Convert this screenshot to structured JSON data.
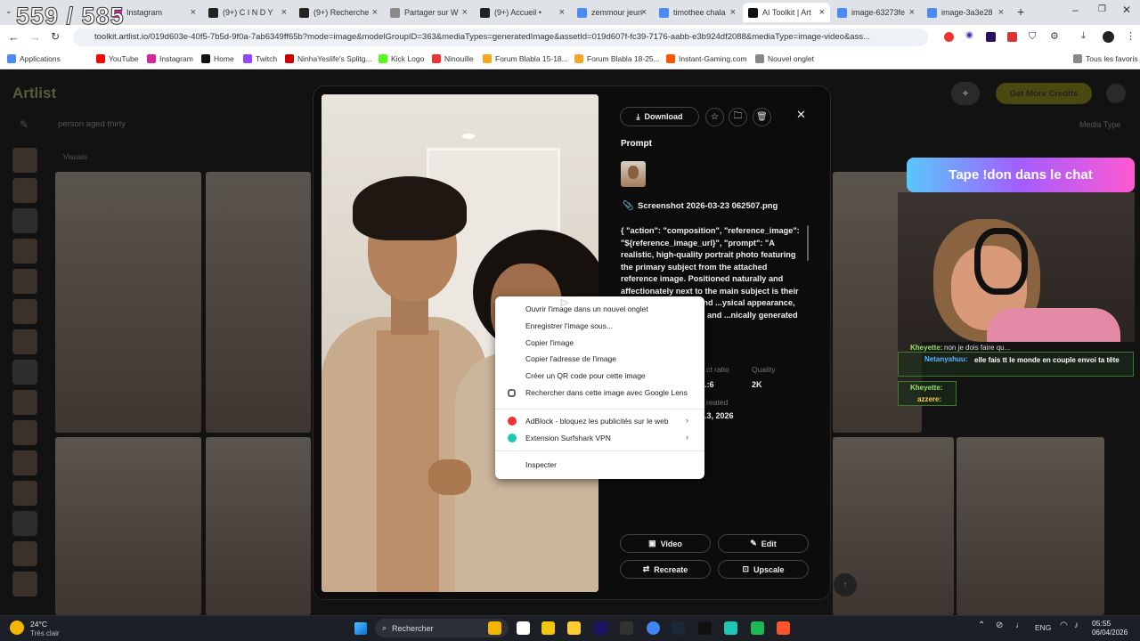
{
  "overlay_title": "559 / 585",
  "tabs": [
    {
      "label": "Instagram",
      "color": "#d6249f"
    },
    {
      "label": "(9+) C I N D Y",
      "color": "#222"
    },
    {
      "label": "(9+) Recherche",
      "color": "#222"
    },
    {
      "label": "Partager sur W",
      "color": "#8a8a8a"
    },
    {
      "label": "(9+) Accueil •",
      "color": "#222"
    },
    {
      "label": "zemmour jeun",
      "color": "#4c8bf5"
    },
    {
      "label": "timothee chala",
      "color": "#4c8bf5"
    },
    {
      "label": "AI Toolkit | Art",
      "color": "#111"
    },
    {
      "label": "image-63273fe",
      "color": "#4c8bf5"
    },
    {
      "label": "image-3a3e28",
      "color": "#4c8bf5"
    }
  ],
  "url": "toolkit.artlist.io/019d603e-40f5-7b5d-9f0a-7ab6349ff65b?mode=image&modelGroupID=363&mediaTypes=generatedImage&assetId=019d607f-fc39-7176-aabb-e3b924df2088&mediaType=image-video&ass...",
  "bookmarks": [
    {
      "label": "Applications",
      "color": "#4c8bf5"
    },
    {
      "label": "YouTube",
      "color": "#ff0000"
    },
    {
      "label": "Instagram",
      "color": "#d6249f"
    },
    {
      "label": "Home",
      "color": "#111"
    },
    {
      "label": "Twitch",
      "color": "#9146ff"
    },
    {
      "label": "NinhaYeslife's Splitg...",
      "color": "#c00"
    },
    {
      "label": "Kick Logo",
      "color": "#53fc18"
    },
    {
      "label": "Ninouille",
      "color": "#e33"
    },
    {
      "label": "Forum Blabla 15-18...",
      "color": "#f5a623"
    },
    {
      "label": "Forum Blabla 18-25...",
      "color": "#f5a623"
    },
    {
      "label": "Instant-Gaming.com",
      "color": "#ff5400"
    },
    {
      "label": "Nouvel onglet",
      "color": "#888"
    },
    {
      "label": "Tous les favoris",
      "color": "#888"
    }
  ],
  "app": {
    "logo": "Artlist",
    "search_text": "person aged thirty",
    "visuals_label": "Visuals",
    "media_type": "Media Type",
    "get_credits": "Get More Credits"
  },
  "modal": {
    "download": "Download",
    "prompt_heading": "Prompt",
    "filename": "Screenshot 2026-03-23 062507.png",
    "prompt_text": "{ \"action\": \"composition\", \"reference_image\": \"${reference_image_url}\", \"prompt\": \"A realistic, high-quality portrait photo featuring the primary subject from the attached reference image. Positioned naturally and affectionately next to the main subject is their girlfriend. The girlfriend ...ysical appearance, ...ture, personal style, and ...nically generated to",
    "aspect_label": "...ct ratio",
    "aspect_value": "...:6",
    "quality_label": "Quality",
    "quality_value": "2K",
    "created_label": "...reated",
    "created_value": "...3, 2026",
    "video": "Video",
    "edit": "Edit",
    "recreate": "Recreate",
    "upscale": "Upscale"
  },
  "context_menu": [
    "Ouvrir l'image dans un nouvel onglet",
    "Enregistrer l'image sous...",
    "Copier l'image",
    "Copier l'adresse de l'image",
    "Créer un QR code pour cette image",
    "Rechercher dans cette image avec Google Lens",
    "AdBlock - bloquez les publicités sur le web",
    "Extension Surfshark VPN",
    "Inspecter"
  ],
  "stream": {
    "banner": "Tape !don dans le chat",
    "chat": [
      {
        "user": "Kheyette:",
        "msg": "non je dois faire qu..."
      },
      {
        "user": "Netanyahuu:",
        "msg": "elle fais tt le monde en couple envoi ta tête"
      },
      {
        "user": "Kheyette:",
        "msg": ""
      },
      {
        "user": "azzere:",
        "msg": ""
      }
    ]
  },
  "taskbar": {
    "temp": "24°C",
    "weather": "Très clair",
    "search": "Rechercher",
    "lang": "ENG",
    "time": "05:55",
    "date": "06/04/2026"
  }
}
